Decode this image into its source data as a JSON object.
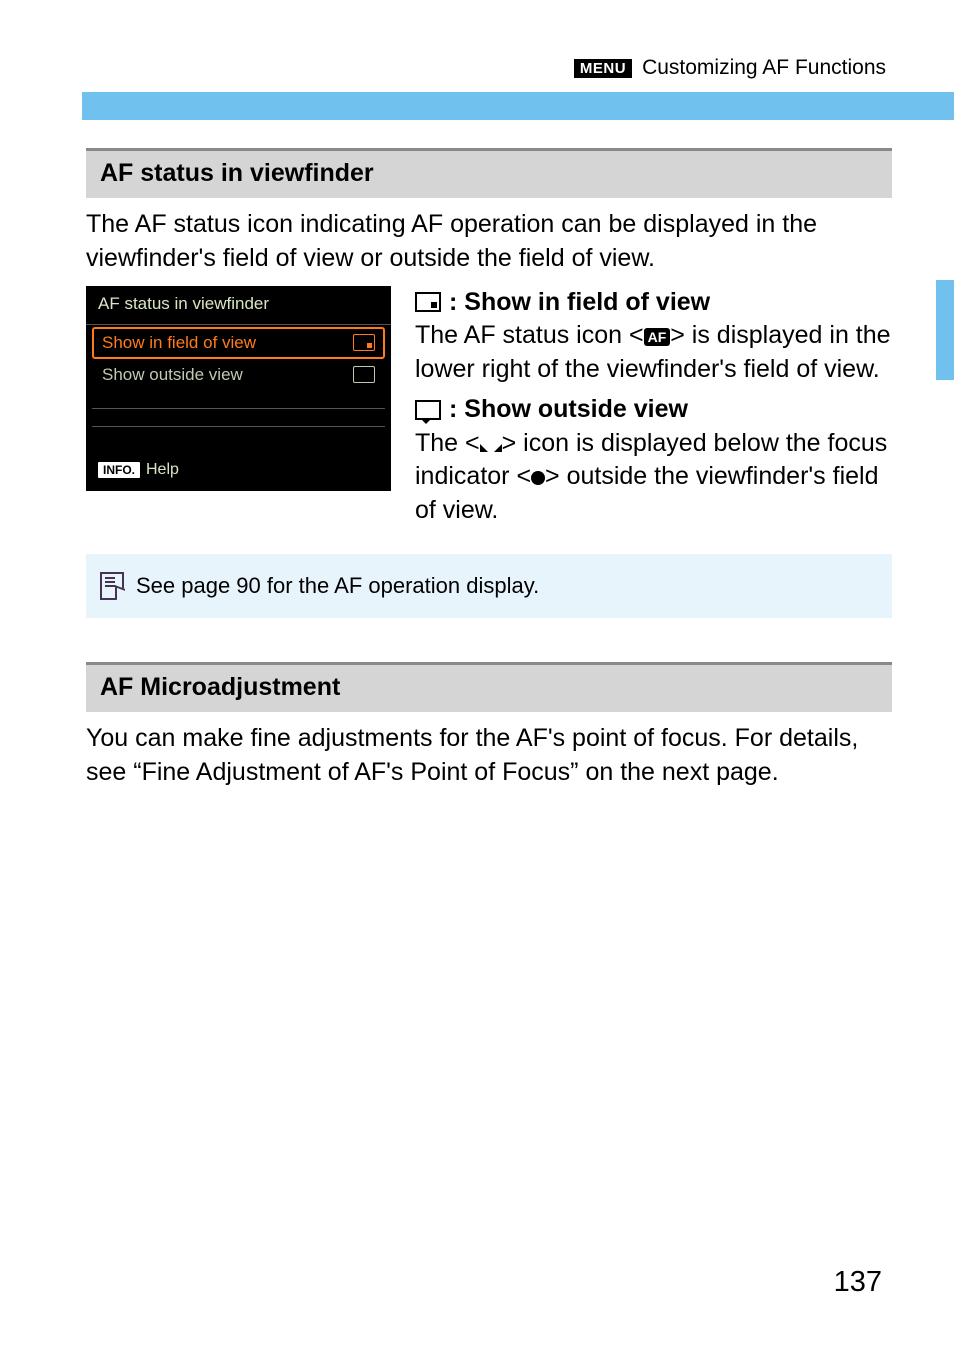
{
  "breadcrumb": {
    "menu_tag": "MENU",
    "title": "Customizing AF Functions"
  },
  "sections": {
    "af_status": {
      "title": "AF status in viewfinder",
      "intro": "The AF status icon indicating AF operation can be displayed in the viewfinder's field of view or outside the field of view.",
      "menu": {
        "title": "AF status in viewfinder",
        "items": [
          {
            "label": "Show in field of view",
            "selected": true
          },
          {
            "label": "Show outside view",
            "selected": false
          }
        ],
        "help": {
          "tag": "INFO.",
          "label": "Help"
        }
      },
      "options": {
        "opt1": {
          "heading": ": Show in field of view",
          "body_pre": "The AF status icon <",
          "body_badge": "AF",
          "body_post": "> is displayed in the lower right of the viewfinder's field of view."
        },
        "opt2": {
          "heading": ": Show outside view",
          "body_pre": "The <",
          "body_mid": "> icon is displayed below the focus indicator <",
          "body_post": "> outside the viewfinder's field of view."
        }
      }
    },
    "note": {
      "text": "See page 90 for the AF operation display."
    },
    "af_micro": {
      "title": "AF Microadjustment",
      "intro": "You can make fine adjustments for the AF's point of focus. For details, see “Fine Adjustment of AF's Point of Focus” on the next page."
    }
  },
  "page_number": "137"
}
